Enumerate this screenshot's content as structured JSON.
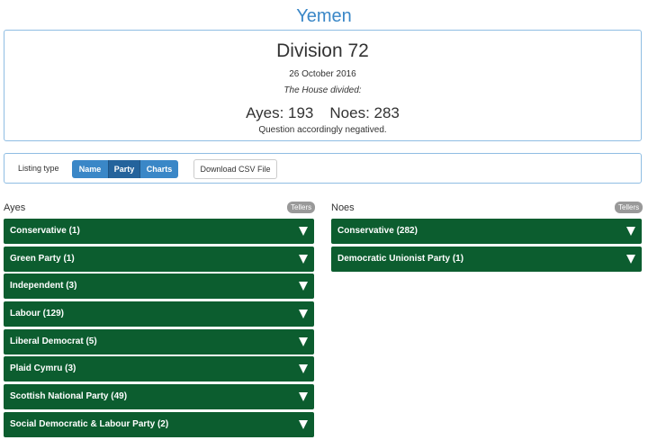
{
  "page": {
    "title": "Yemen"
  },
  "division": {
    "heading": "Division 72",
    "date": "26 October 2016",
    "divided_text": "The House divided:",
    "ayes_text": "Ayes: 193",
    "noes_text": "Noes: 283",
    "result": "Question accordingly negatived."
  },
  "listing": {
    "label": "Listing type",
    "options": [
      "Name",
      "Party",
      "Charts"
    ],
    "selected": "Party",
    "csv_label": "Download CSV File"
  },
  "ayes": {
    "heading": "Ayes",
    "tellers_label": "Tellers",
    "parties": [
      "Conservative (1)",
      "Green Party (1)",
      "Independent (3)",
      "Labour (129)",
      "Liberal Democrat (5)",
      "Plaid Cymru (3)",
      "Scottish National Party (49)",
      "Social Democratic & Labour Party (2)"
    ]
  },
  "noes": {
    "heading": "Noes",
    "tellers_label": "Tellers",
    "parties": [
      "Conservative (282)",
      "Democratic Unionist Party (1)"
    ]
  },
  "colors": {
    "accent": "#3a87c7",
    "party_bar": "#0c5d2f",
    "selected_segment": "#24639c",
    "tellers_badge": "#999999"
  },
  "icons": {
    "expand": "triangle-down-icon"
  }
}
